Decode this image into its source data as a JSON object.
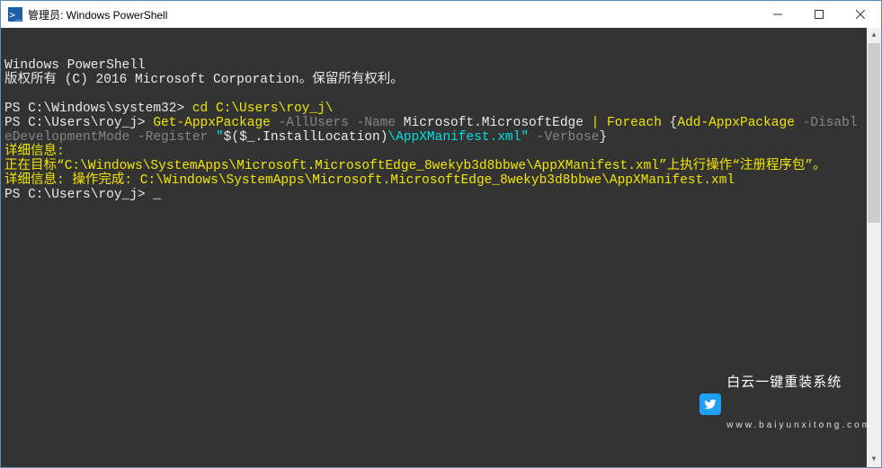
{
  "window": {
    "title": "管理员: Windows PowerShell"
  },
  "terminal": {
    "header1": "Windows PowerShell",
    "header2": "版权所有 (C) 2016 Microsoft Corporation。保留所有权利。",
    "line1_prompt": "PS C:\\Windows\\system32> ",
    "line1_cmd": "cd C:\\Users\\roy_j\\",
    "line2_prompt": "PS C:\\Users\\roy_j> ",
    "line2_cmd1": "Get-AppxPackage",
    "line2_arg1": " -AllUsers -Name ",
    "line2_val1": "Microsoft.MicrosoftEdge ",
    "line2_pipe": "| ",
    "line2_cmd2": "Foreach ",
    "line2_brace_open": "{",
    "line2_cmd3": "Add-AppxPackage",
    "line2_arg2": " -DisableDevelopmentMode -Register ",
    "line2_quote_open": "\"",
    "line2_expr1": "$(",
    "line2_expr2": "$_",
    "line2_expr3": ".",
    "line2_expr4": "InstallLocation",
    "line2_expr5": ")",
    "line2_path": "\\AppXManifest.xml\"",
    "line2_arg3": " -Verbose",
    "line2_brace_close": "}",
    "line3_label": "详细信息: ",
    "line3_text": "正在目标“C:\\Windows\\SystemApps\\Microsoft.MicrosoftEdge_8wekyb3d8bbwe\\AppXManifest.xml”上执行操作“注册程序包”。",
    "line4_label": "详细信息: ",
    "line4_text": "操作完成: C:\\Windows\\SystemApps\\Microsoft.MicrosoftEdge_8wekyb3d8bbwe\\AppXManifest.xml",
    "line5_prompt": "PS C:\\Users\\roy_j> ",
    "cursor": "_"
  },
  "watermark": {
    "big": "白云一键重装系统",
    "small": "www.baiyunxitong.com"
  }
}
